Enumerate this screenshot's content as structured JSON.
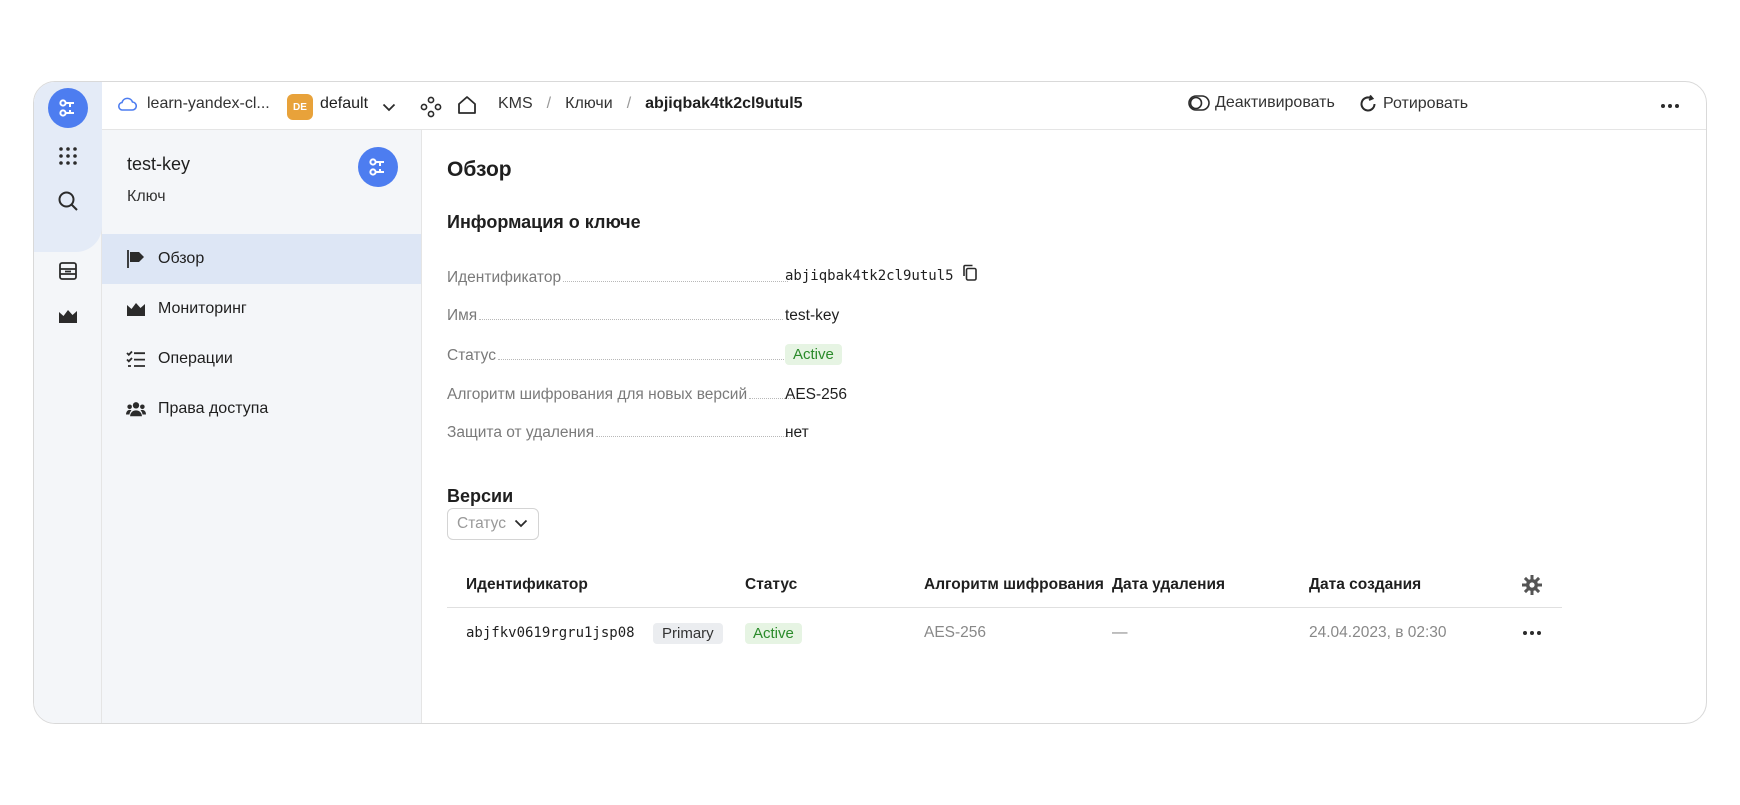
{
  "topbar": {
    "cloud_name": "learn-yandex-cl...",
    "folder_badge": "DE",
    "folder_name": "default",
    "breadcrumbs": [
      "KMS",
      "Ключи",
      "abjiqbak4tk2cl9utul5"
    ],
    "deactivate_label": "Деактивировать",
    "rotate_label": "Ротировать"
  },
  "sidebar": {
    "title": "test-key",
    "subtitle": "Ключ",
    "items": [
      {
        "label": "Обзор",
        "icon": "flag-icon",
        "active": true
      },
      {
        "label": "Мониторинг",
        "icon": "chart-area-icon"
      },
      {
        "label": "Операции",
        "icon": "list-check-icon"
      },
      {
        "label": "Права доступа",
        "icon": "persons-icon"
      }
    ]
  },
  "main": {
    "title": "Обзор",
    "info_heading": "Информация о ключе",
    "info": [
      {
        "label": "Идентификатор",
        "value": "abjiqbak4tk2cl9utul5"
      },
      {
        "label": "Имя",
        "value": "test-key"
      },
      {
        "label": "Статус",
        "value": "Active"
      },
      {
        "label": "Алгоритм шифрования для новых версий",
        "value": "AES-256"
      },
      {
        "label": "Защита от удаления",
        "value": "нет"
      }
    ],
    "versions_heading": "Версии",
    "status_filter_placeholder": "Статус",
    "table": {
      "columns": [
        "Идентификатор",
        "Статус",
        "Алгоритм шифрования",
        "Дата удаления",
        "Дата создания"
      ],
      "rows": [
        {
          "id": "abjfkv0619rgru1jsp08",
          "tag": "Primary",
          "status": "Active",
          "algorithm": "AES-256",
          "deleted": "—",
          "created": "24.04.2023, в 02:30"
        }
      ]
    }
  },
  "colors": {
    "accent": "#4d7df0",
    "active_green": "#2a8a2a",
    "folder_badge": "#e8a23a"
  }
}
